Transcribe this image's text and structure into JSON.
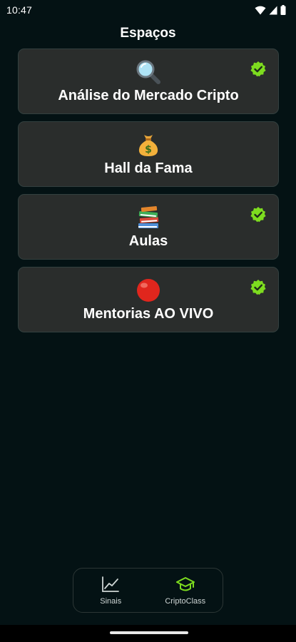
{
  "status_bar": {
    "time": "10:47",
    "icons": [
      "wifi-icon",
      "signal-icon",
      "battery-icon"
    ]
  },
  "header": {
    "title": "Espaços"
  },
  "spaces": [
    {
      "label": "Análise do Mercado Cripto",
      "icon": "magnifying-glass-icon",
      "verified": true
    },
    {
      "label": "Hall da Fama",
      "icon": "money-bag-icon",
      "verified": false
    },
    {
      "label": "Aulas",
      "icon": "books-icon",
      "verified": true
    },
    {
      "label": "Mentorias AO VIVO",
      "icon": "red-circle-icon",
      "verified": true
    }
  ],
  "bottom_nav": {
    "items": [
      {
        "label": "Sinais",
        "icon": "chart-line-icon",
        "active": false
      },
      {
        "label": "CriptoClass",
        "icon": "graduation-cap-icon",
        "active": true
      }
    ]
  },
  "colors": {
    "background": "#041214",
    "card": "#2a2d2c",
    "accent_green": "#7ddc1f",
    "text": "#ffffff"
  }
}
